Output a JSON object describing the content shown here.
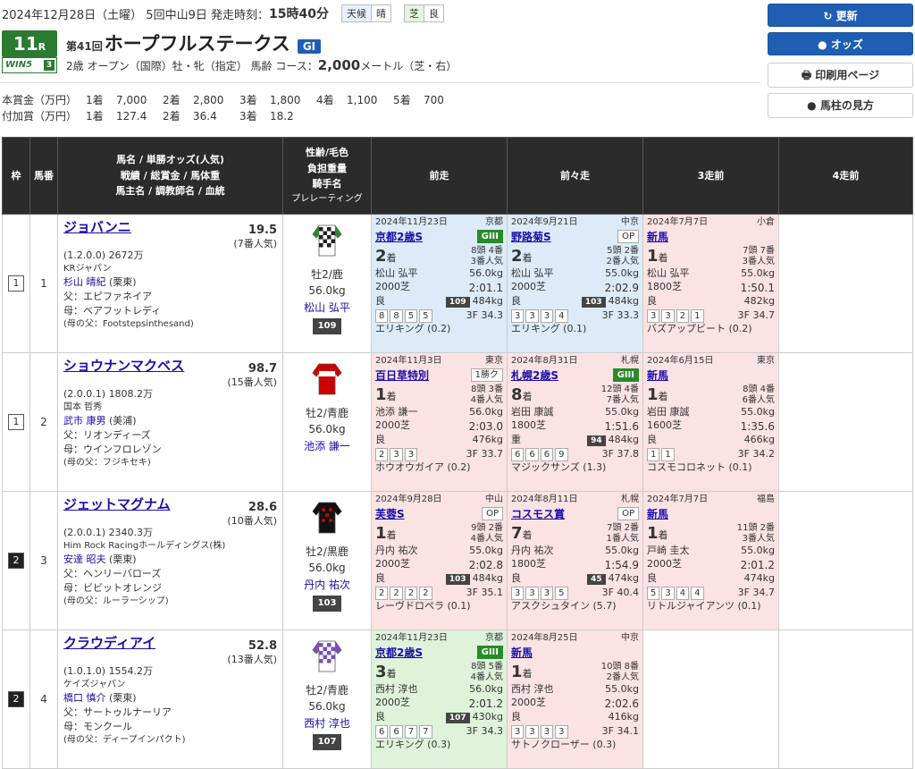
{
  "header": {
    "date_info": "2024年12月28日（土曜） 5回中山9日 発走時刻：",
    "post_time": "15時40分",
    "weather_label": "天候",
    "weather": "晴",
    "track_label": "芝",
    "track_cond": "良",
    "race_no": "11",
    "race_no_suffix": "R",
    "win5_label": "WIN5",
    "win5_no": "3",
    "edition": "第41回",
    "race_name": "ホープフルステークス",
    "grade": "GI",
    "conditions": "2歳 オープン（国際）牡・牝（指定） 馬齢 コース：",
    "distance": "2,000",
    "distance_unit": "メートル（芝・右）",
    "prize_label": "本賞金（万円）",
    "prizes": [
      "1着",
      "7,000",
      "2着",
      "2,800",
      "3着",
      "1,800",
      "4着",
      "1,100",
      "5着",
      "700"
    ],
    "bonus_label": "付加賞（万円）",
    "bonuses": [
      "1着",
      "127.4",
      "2着",
      "36.4",
      "3着",
      "18.2"
    ]
  },
  "buttons": {
    "refresh": "↻ 更新",
    "odds": "● オッズ",
    "print": "🖶 印刷用ページ",
    "guide": "● 馬柱の見方"
  },
  "table_headers": {
    "waku": "枠",
    "umaban": "馬番",
    "horse": [
      "馬名 / 単勝オッズ(人気)",
      "戦績 / 総賞金 / 馬体重",
      "馬主名 / 調教師名 / 血統"
    ],
    "jockey": [
      "性齢/毛色",
      "負担重量",
      "騎手名",
      "プレレーティング"
    ],
    "prev1": "前走",
    "prev2": "前々走",
    "prev3": "3走前",
    "prev4": "4走前"
  },
  "horses": [
    {
      "waku": "1",
      "umaban": "1",
      "name": "ジョバンニ",
      "odds": "19.5",
      "pop": "(7番人気)",
      "record": "(1.2.0.0) 2672万",
      "owner": "KRジャパン",
      "trainer": "杉山 晴紀",
      "stable": "(栗東)",
      "sire": "父：エピファネイア",
      "dam": "母：ベアフットレディ",
      "damsire": "(母の父：Footstepsinthesand)",
      "sexage": "牡2/鹿",
      "weight": "56.0kg",
      "jockey": "松山 弘平",
      "rating": "109",
      "races": [
        {
          "date": "2024年11月23日",
          "course": "京都",
          "name": "京都2歳S",
          "grade": "GIII",
          "place": "2",
          "unit": "着",
          "heads": "8頭 4番",
          "pop": "3番人気",
          "jockey": "松山 弘平",
          "kg": "56.0kg",
          "dist": "2000芝",
          "time": "2:01.1",
          "cond": "良",
          "rt": "109",
          "bw": "484kg",
          "corners": [
            "8",
            "8",
            "5",
            "5"
          ],
          "f3": "3F 34.3",
          "winner": "エリキング (0.2)"
        },
        {
          "date": "2024年9月21日",
          "course": "中京",
          "name": "野路菊S",
          "grade": "OP",
          "place": "2",
          "unit": "着",
          "heads": "5頭 2番",
          "pop": "2番人気",
          "jockey": "松山 弘平",
          "kg": "55.0kg",
          "dist": "2000芝",
          "time": "2:02.9",
          "cond": "良",
          "rt": "103",
          "bw": "484kg",
          "corners": [
            "3",
            "3",
            "3",
            "4"
          ],
          "f3": "3F 33.3",
          "winner": "エリキング (0.1)"
        },
        {
          "date": "2024年7月7日",
          "course": "小倉",
          "name": "新馬",
          "grade": "",
          "place": "1",
          "unit": "着",
          "heads": "7頭 7番",
          "pop": "3番人気",
          "jockey": "松山 弘平",
          "kg": "55.0kg",
          "dist": "1800芝",
          "time": "1:50.1",
          "cond": "良",
          "rt": "",
          "bw": "482kg",
          "corners": [
            "3",
            "3",
            "2",
            "1"
          ],
          "f3": "3F 34.7",
          "winner": "バズアップビート (0.2)"
        }
      ]
    },
    {
      "waku": "1",
      "umaban": "2",
      "name": "ショウナンマクベス",
      "odds": "98.7",
      "pop": "(15番人気)",
      "record": "(2.0.0.1) 1808.2万",
      "owner": "国本 哲秀",
      "trainer": "武市 康男",
      "stable": "(美浦)",
      "sire": "父：リオンディーズ",
      "dam": "母：ウインフロレゾン",
      "damsire": "(母の父：フジキセキ)",
      "sexage": "牡2/青鹿",
      "weight": "56.0kg",
      "jockey": "池添 謙一",
      "rating": "",
      "races": [
        {
          "date": "2024年11月3日",
          "course": "東京",
          "name": "百日草特別",
          "grade": "1勝ク",
          "place": "1",
          "unit": "着",
          "heads": "8頭 3番",
          "pop": "4番人気",
          "jockey": "池添 謙一",
          "kg": "56.0kg",
          "dist": "2000芝",
          "time": "2:03.0",
          "cond": "良",
          "rt": "",
          "bw": "476kg",
          "corners": [
            "2",
            "3",
            "3"
          ],
          "f3": "3F 33.7",
          "winner": "ホウオウガイア (0.2)"
        },
        {
          "date": "2024年8月31日",
          "course": "札幌",
          "name": "札幌2歳S",
          "grade": "GIII",
          "place": "8",
          "unit": "着",
          "heads": "12頭 4番",
          "pop": "7番人気",
          "jockey": "岩田 康誠",
          "kg": "55.0kg",
          "dist": "1800芝",
          "time": "1:51.6",
          "cond": "重",
          "rt": "94",
          "bw": "484kg",
          "corners": [
            "6",
            "6",
            "6",
            "9"
          ],
          "f3": "3F 37.8",
          "winner": "マジックサンズ (1.3)"
        },
        {
          "date": "2024年6月15日",
          "course": "東京",
          "name": "新馬",
          "grade": "",
          "place": "1",
          "unit": "着",
          "heads": "8頭 4番",
          "pop": "6番人気",
          "jockey": "岩田 康誠",
          "kg": "55.0kg",
          "dist": "1600芝",
          "time": "1:35.6",
          "cond": "良",
          "rt": "",
          "bw": "466kg",
          "corners": [
            "1",
            "1"
          ],
          "f3": "3F 34.2",
          "winner": "コスモコロネット (0.1)"
        }
      ]
    },
    {
      "waku": "2",
      "umaban": "3",
      "name": "ジェットマグナム",
      "odds": "28.6",
      "pop": "(10番人気)",
      "record": "(2.0.0.1) 2340.3万",
      "owner": "Him Rock Racingホールディングス(株)",
      "trainer": "安達 昭夫",
      "stable": "(栗東)",
      "sire": "父：ヘンリーバローズ",
      "dam": "母：ビビットオレンジ",
      "damsire": "(母の父：ルーラーシップ)",
      "sexage": "牡2/黒鹿",
      "weight": "56.0kg",
      "jockey": "丹内 祐次",
      "rating": "103",
      "races": [
        {
          "date": "2024年9月28日",
          "course": "中山",
          "name": "芙蓉S",
          "grade": "OP",
          "place": "1",
          "unit": "着",
          "heads": "9頭 2番",
          "pop": "4番人気",
          "jockey": "丹内 祐次",
          "kg": "55.0kg",
          "dist": "2000芝",
          "time": "2:02.8",
          "cond": "良",
          "rt": "103",
          "bw": "484kg",
          "corners": [
            "2",
            "2",
            "2",
            "2"
          ],
          "f3": "3F 35.1",
          "winner": "レーヴドロペラ (0.1)"
        },
        {
          "date": "2024年8月11日",
          "course": "札幌",
          "name": "コスモス賞",
          "grade": "OP",
          "place": "7",
          "unit": "着",
          "heads": "7頭 2番",
          "pop": "1番人気",
          "jockey": "丹内 祐次",
          "kg": "55.0kg",
          "dist": "1800芝",
          "time": "1:54.9",
          "cond": "良",
          "rt": "45",
          "bw": "474kg",
          "corners": [
            "3",
            "3",
            "3",
            "5"
          ],
          "f3": "3F 40.4",
          "winner": "アスクシュタイン (5.7)"
        },
        {
          "date": "2024年7月7日",
          "course": "福島",
          "name": "新馬",
          "grade": "",
          "place": "1",
          "unit": "着",
          "heads": "11頭 2番",
          "pop": "3番人気",
          "jockey": "戸崎 圭太",
          "kg": "55.0kg",
          "dist": "2000芝",
          "time": "2:01.2",
          "cond": "良",
          "rt": "",
          "bw": "474kg",
          "corners": [
            "5",
            "3",
            "4",
            "4"
          ],
          "f3": "3F 34.7",
          "winner": "リトルジャイアンツ (0.1)"
        }
      ]
    },
    {
      "waku": "2",
      "umaban": "4",
      "name": "クラウディアイ",
      "odds": "52.8",
      "pop": "(13番人気)",
      "record": "(1.0.1.0) 1554.2万",
      "owner": "ケイズジャパン",
      "trainer": "橋口 慎介",
      "stable": "(栗東)",
      "sire": "父：サートゥルナーリア",
      "dam": "母：モンクール",
      "damsire": "(母の父：ディープインパクト)",
      "sexage": "牡2/青鹿",
      "weight": "56.0kg",
      "jockey": "西村 淳也",
      "rating": "107",
      "races": [
        {
          "date": "2024年11月23日",
          "course": "京都",
          "name": "京都2歳S",
          "grade": "GIII",
          "place": "3",
          "unit": "着",
          "heads": "8頭 5番",
          "pop": "4番人気",
          "jockey": "西村 淳也",
          "kg": "56.0kg",
          "dist": "2000芝",
          "time": "2:01.2",
          "cond": "良",
          "rt": "107",
          "bw": "430kg",
          "corners": [
            "6",
            "6",
            "7",
            "7"
          ],
          "f3": "3F 34.3",
          "winner": "エリキング (0.3)"
        },
        {
          "date": "2024年8月25日",
          "course": "中京",
          "name": "新馬",
          "grade": "",
          "place": "1",
          "unit": "着",
          "heads": "10頭 8番",
          "pop": "2番人気",
          "jockey": "西村 淳也",
          "kg": "55.0kg",
          "dist": "2000芝",
          "time": "2:02.6",
          "cond": "良",
          "rt": "",
          "bw": "416kg",
          "corners": [
            "3",
            "3",
            "3",
            "3"
          ],
          "f3": "3F 34.1",
          "winner": "サトノクローザー (0.3)"
        }
      ]
    }
  ]
}
